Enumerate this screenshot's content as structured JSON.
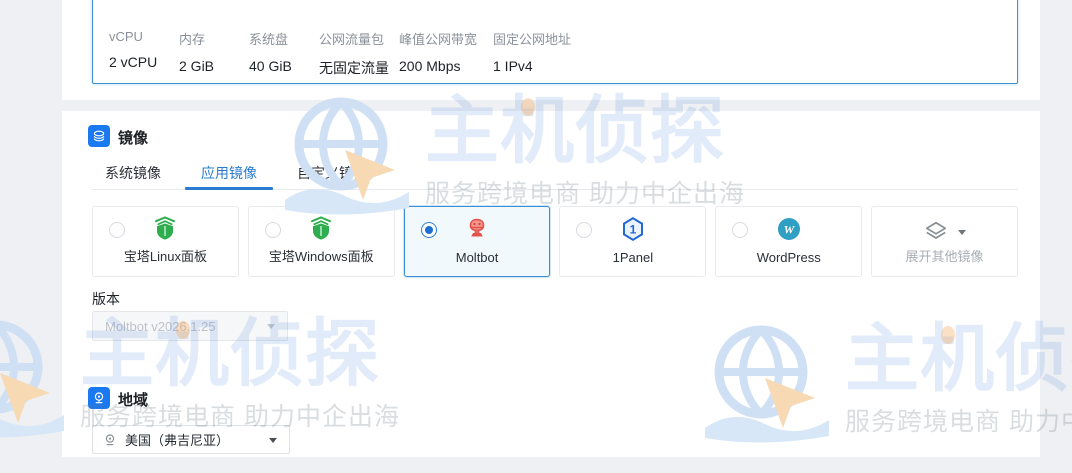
{
  "watermark": {
    "brand": "主机侦探",
    "slogan": "服务跨境电商 助力中企出海"
  },
  "spec_summary": {
    "items": [
      {
        "label": "vCPU",
        "value": "2 vCPU"
      },
      {
        "label": "内存",
        "value": "2 GiB"
      },
      {
        "label": "系统盘",
        "value": "40 GiB"
      },
      {
        "label": "公网流量包",
        "value": "无固定流量"
      },
      {
        "label": "峰值公网带宽",
        "value": "200 Mbps"
      },
      {
        "label": "固定公网地址",
        "value": "1 IPv4"
      }
    ]
  },
  "image_section": {
    "title": "镜像",
    "tabs": [
      {
        "label": "系统镜像",
        "active": false
      },
      {
        "label": "应用镜像",
        "active": true
      },
      {
        "label": "自定义镜像",
        "active": false
      }
    ],
    "options": [
      {
        "label": "宝塔Linux面板",
        "icon": "baota-shield",
        "selected": false
      },
      {
        "label": "宝塔Windows面板",
        "icon": "baota-shield",
        "selected": false
      },
      {
        "label": "Moltbot",
        "icon": "moltbot-lobster",
        "selected": true
      },
      {
        "label": "1Panel",
        "icon": "1panel-hexagon",
        "selected": false
      },
      {
        "label": "WordPress",
        "icon": "wordpress-circle",
        "selected": false
      }
    ],
    "expand_label": "展开其他镜像",
    "version_label": "版本",
    "version_value": "Moltbot v2026.1.25"
  },
  "region_section": {
    "title": "地域",
    "selected_region": "美国（弗吉尼亚）"
  },
  "icon_glyphs": {
    "onepanel_digit": "1",
    "wordpress_letter": "W"
  },
  "colors": {
    "accent_blue": "#2b7cd0",
    "section_icon_blue": "#1a78f0",
    "selected_border": "#3c8fd2",
    "selected_bg": "#f2f9fd",
    "spec_box_border": "#3f92d4",
    "baota_green": "#2eae4e",
    "moltbot_red": "#e2514a",
    "onepanel_blue": "#2468d4",
    "wordpress_teal": "#2f9fc4",
    "page_bg": "#eef0f3"
  }
}
